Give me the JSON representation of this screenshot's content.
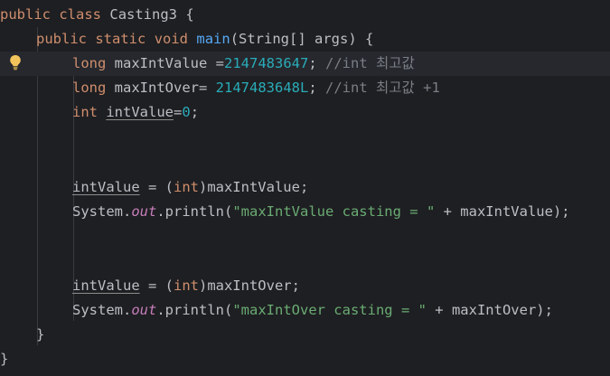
{
  "code": {
    "class_line": {
      "kw1": "public",
      "kw2": "class",
      "name": "Casting3",
      "brace": "{"
    },
    "method_line": {
      "kw1": "public",
      "kw2": "static",
      "kw3": "void",
      "name": "main",
      "params": "(String[] args) {"
    },
    "line_long1": {
      "type": "long",
      "decl": "maxIntValue =",
      "value": "2147483647",
      "semi": ";",
      "comment": "//int 최고값"
    },
    "line_long2": {
      "type": "long",
      "decl": "maxIntOver=",
      "value": "2147483648L",
      "semi": ";",
      "comment": "//int 최고값 +1"
    },
    "line_int": {
      "type": "int",
      "var": "intValue",
      "eq": "=",
      "value": "0",
      "semi": ";"
    },
    "assign1": {
      "var": "intValue",
      "op": " = (",
      "cast": "int",
      "rest": ")maxIntValue;"
    },
    "print1": {
      "obj": "System.",
      "field": "out",
      "call": ".println(",
      "str": "\"maxIntValue casting = \"",
      "rest": " + maxIntValue);"
    },
    "assign2": {
      "var": "intValue",
      "op": " = (",
      "cast": "int",
      "rest": ")maxIntOver;"
    },
    "print2": {
      "obj": "System.",
      "field": "out",
      "call": ".println(",
      "str": "\"maxIntOver casting = \"",
      "rest": " + maxIntOver);"
    },
    "close_method": "}",
    "close_class": "}"
  },
  "icons": {
    "intention": "lightbulb-icon"
  },
  "colors": {
    "background": "#1e1f22",
    "keyword": "#cf8e6d",
    "method": "#56a8f5",
    "number": "#2aacb8",
    "string": "#6aab73",
    "comment": "#7a7e85",
    "static_field": "#c77dbb",
    "bulb": "#f2c55c"
  }
}
